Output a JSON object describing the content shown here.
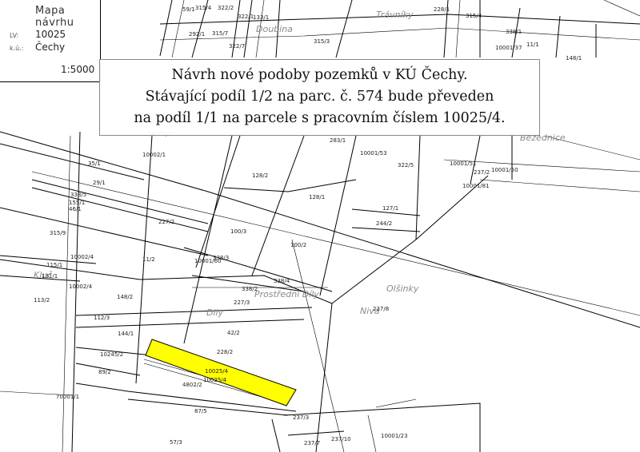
{
  "legend": {
    "title": "Mapa návrhu",
    "lv_label": "LV:",
    "lv_value": "10025",
    "ku_label": "k.ú.:",
    "ku_value": "Čechy",
    "scale": "1:5000"
  },
  "caption": {
    "line1": "Návrh nové podoby pozemků v KÚ Čechy.",
    "line2": "Stávající podíl 1/2 na parc. č. 574 bude převeden",
    "line3": "na podíl 1/1 na parcele s pracovním číslem 10025/4."
  },
  "colors": {
    "highlight": "#ffff00",
    "line": "#000000",
    "locality": "#8a8a8a"
  },
  "localities": [
    "Trávníky",
    "Doubina",
    "Bezednice",
    "Kluč",
    "Dlly",
    "Prostřední Díly",
    "Olšinky",
    "Niva"
  ],
  "parcels": [
    "59/1",
    "315/4",
    "322/2",
    "292/1",
    "315/7",
    "322/1",
    "133/1",
    "322/7",
    "315/3",
    "228/1",
    "315/4",
    "338/1",
    "10001/37",
    "11/1",
    "148/1",
    "10003/21",
    "10002/1",
    "35/1",
    "29/1",
    "338/5",
    "155/1",
    "46/1",
    "315/9",
    "10002/4",
    "115/1",
    "131/1",
    "10002/4",
    "113/2",
    "283/1",
    "10001/53",
    "322/5",
    "10001/51",
    "237/2",
    "10001/50",
    "10001/81",
    "128/2",
    "128/1",
    "127/1",
    "244/2",
    "227/2",
    "100/3",
    "100/2",
    "11/2",
    "10001/60",
    "338/3",
    "338/4",
    "338/2",
    "148/2",
    "227/3",
    "112/3",
    "144/1",
    "42/2",
    "10245/2",
    "228/2",
    "89/2",
    "10025/4",
    "10025/4",
    "4802/2",
    "237/8",
    "70001/1",
    "87/5",
    "237/3",
    "57/3",
    "237/7",
    "237/10",
    "10001/23"
  ]
}
